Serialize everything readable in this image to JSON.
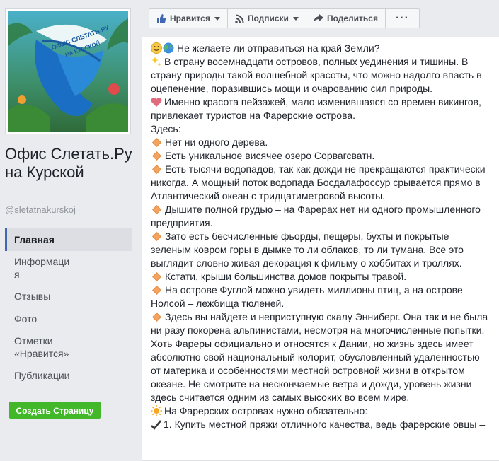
{
  "page": {
    "name": "Офис Слетать.Ру на Курской",
    "handle": "@sletatnakurskoj",
    "logo_text_1": "ОФИС СЛЕТАТЬ.РУ",
    "logo_text_2": "НА КУРСКОЙ"
  },
  "nav": {
    "items": [
      {
        "label": "Главная",
        "active": true
      },
      {
        "label": "Информация"
      },
      {
        "label": "Отзывы"
      },
      {
        "label": "Фото"
      },
      {
        "label": "Отметки «Нравится»"
      },
      {
        "label": "Публикации"
      }
    ],
    "create_page": "Создать Страницу"
  },
  "actions": {
    "like": "Нравится",
    "subscriptions": "Подписки",
    "share": "Поделиться",
    "more": "···"
  },
  "post": {
    "lines": [
      {
        "icon": "smile-globe",
        "text": "Не желаете ли отправиться на край Земли?"
      },
      {
        "icon": "sparkles",
        "text": "В страну восемнадцати островов, полных уединения и тишины. В страну природы такой волшебной красоты, что можно надолго впасть в оцепенение, поразившись мощи и очарованию сил природы."
      },
      {
        "icon": "heart",
        "text": "Именно красота пейзажей, мало изменившаяся со времен викингов, привлекает туристов на Фарерские острова."
      },
      {
        "icon": "",
        "text": "Здесь:"
      },
      {
        "icon": "diamond",
        "text": "Нет ни одного дерева."
      },
      {
        "icon": "diamond",
        "text": "Есть уникальное висячее озеро Сорвагсватн."
      },
      {
        "icon": "diamond",
        "text": "Есть тысячи водопадов, так как дожди не прекращаются практически никогда. А мощный поток водопада Босдалафоссур срывается прямо в Атлантический океан с тридцатиметровой высоты."
      },
      {
        "icon": "diamond",
        "text": "Дышите полной грудью – на Фарерах нет ни одного промышленного предприятия."
      },
      {
        "icon": "diamond",
        "text": "Зато есть бесчисленные фьорды, пещеры, бухты и покрытые зеленым ковром горы в дымке то ли облаков, то ли тумана. Все это выглядит словно живая декорация к фильму о хоббитах и троллях."
      },
      {
        "icon": "diamond",
        "text": "Кстати, крыши большинства домов покрыты травой."
      },
      {
        "icon": "diamond",
        "text": "На острове Фуглой можно увидеть миллионы птиц, а на острове Нолсой – лежбища тюленей."
      },
      {
        "icon": "diamond",
        "text": "Здесь вы найдете и неприступную скалу Энниберг. Она так и не была ни разу покорена альпинистами, несмотря на многочисленные попытки."
      },
      {
        "icon": "",
        "text": "Хоть Фареры официально и относятся к Дании, но жизнь здесь имеет абсолютно свой национальный колорит, обусловленный удаленностью от материка и особенностями местной островной жизни в открытом океане. Не смотрите на нескончаемые ветра и дожди, уровень жизни здесь считается одним из самых высоких во всем мире."
      },
      {
        "icon": "sun",
        "text": "На Фарерских островах нужно обязательно:"
      },
      {
        "icon": "check",
        "text": "1. Купить местной пряжи отличного качества, ведь фарерские овцы –"
      }
    ]
  },
  "colors": {
    "brand": "#4267b2",
    "create_button": "#42b72a",
    "diamond": "#f4a460"
  }
}
